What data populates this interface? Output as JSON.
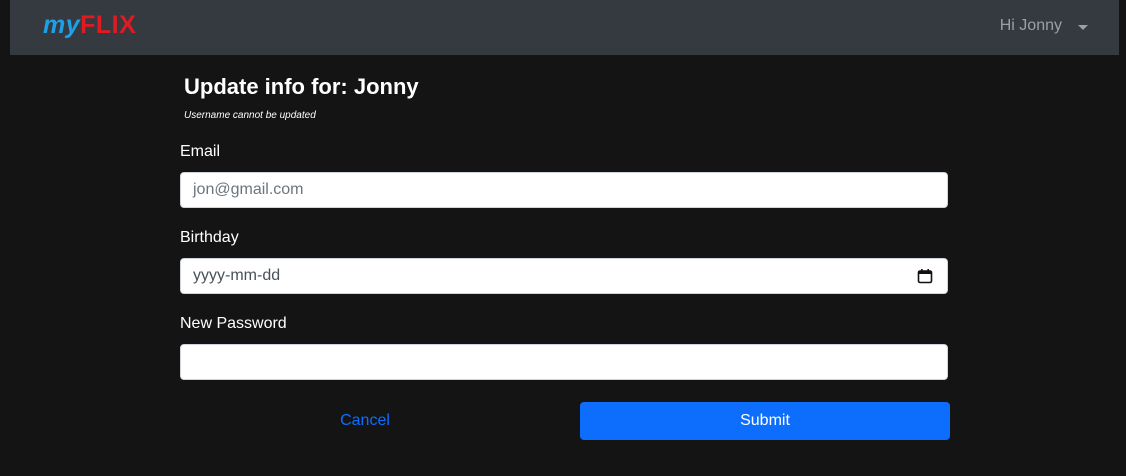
{
  "navbar": {
    "brand_my": "my",
    "brand_flix": "FLIX",
    "user_greeting": "Hi Jonny",
    "caret_icon": "chevron-down-icon"
  },
  "form": {
    "title": "Update info for: Jonny",
    "subtitle": "Username cannot be updated",
    "email": {
      "label": "Email",
      "placeholder": "jon@gmail.com",
      "value": ""
    },
    "birthday": {
      "label": "Birthday",
      "display": "yyyy-mm-dd",
      "icon": "calendar-icon"
    },
    "password": {
      "label": "New Password",
      "value": ""
    },
    "cancel_label": "Cancel",
    "submit_label": "Submit"
  },
  "colors": {
    "background": "#141414",
    "navbar": "#343a40",
    "primary": "#0d6efd",
    "brand_blue": "#1ea0e8",
    "brand_red": "#e11a22"
  }
}
